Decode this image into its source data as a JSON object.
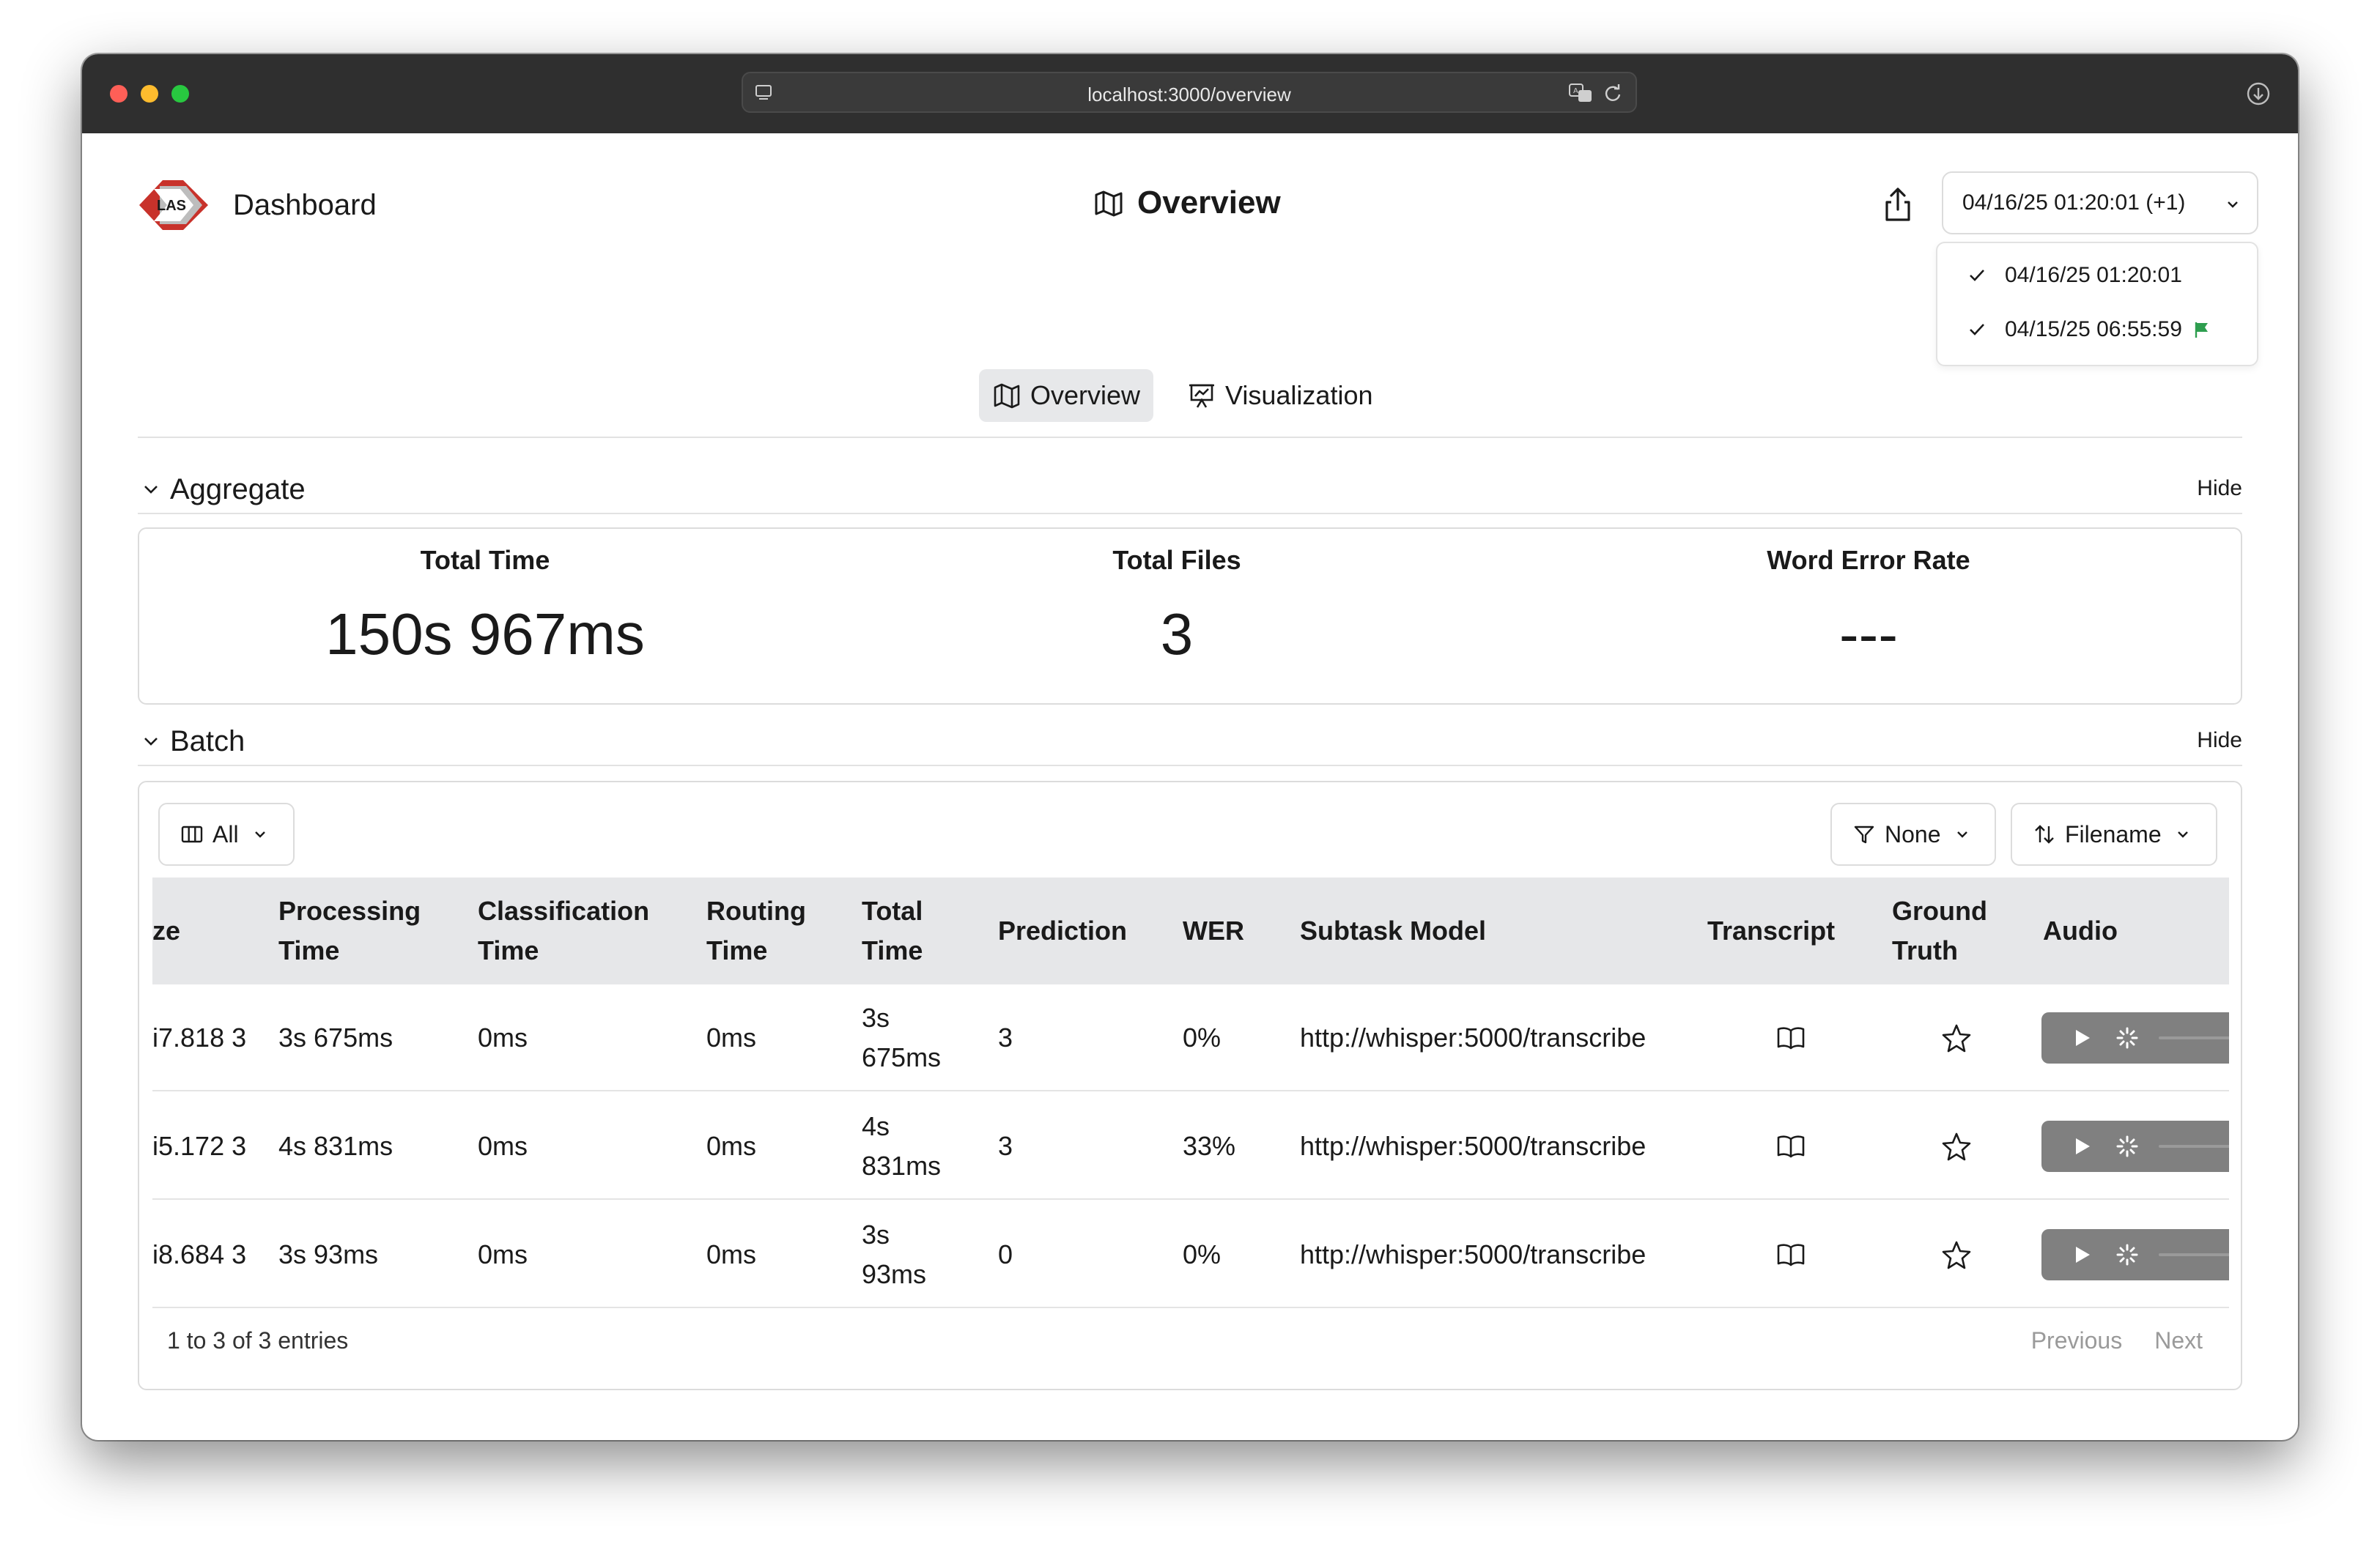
{
  "browser": {
    "url": "localhost:3000/overview"
  },
  "header": {
    "brand": "Dashboard",
    "logo_text": "LAS",
    "page_title": "Overview",
    "date_select": "04/16/25 01:20:01 (+1)",
    "date_options": [
      {
        "label": "04/16/25 01:20:01",
        "checked": true,
        "flag": false
      },
      {
        "label": "04/15/25 06:55:59",
        "checked": true,
        "flag": true
      }
    ]
  },
  "tabs": [
    {
      "label": "Overview",
      "active": true
    },
    {
      "label": "Visualization",
      "active": false
    }
  ],
  "aggregate": {
    "title": "Aggregate",
    "hide_label": "Hide",
    "metrics": [
      {
        "label": "Total Time",
        "value": "150s 967ms"
      },
      {
        "label": "Total Files",
        "value": "3"
      },
      {
        "label": "Word Error Rate",
        "value": "---"
      }
    ]
  },
  "batch": {
    "title": "Batch",
    "hide_label": "Hide",
    "columns_button": "All",
    "filter_button": "None",
    "sort_button": "Filename",
    "columns": [
      "ze",
      "Processing Time",
      "Classification Time",
      "Routing Time",
      "Total Time",
      "Prediction",
      "WER",
      "Subtask Model",
      "Transcript",
      "Ground Truth",
      "Audio"
    ],
    "rows": [
      {
        "size": "i7.818 3",
        "processing": "3s 675ms",
        "classification": "0ms",
        "routing": "0ms",
        "total": "3s 675ms",
        "prediction": "3",
        "wer": "0%",
        "model": "http://whisper:5000/transcribe"
      },
      {
        "size": "i5.172 3",
        "processing": "4s 831ms",
        "classification": "0ms",
        "routing": "0ms",
        "total": "4s 831ms",
        "prediction": "3",
        "wer": "33%",
        "model": "http://whisper:5000/transcribe"
      },
      {
        "size": "i8.684 3",
        "processing": "3s 93ms",
        "classification": "0ms",
        "routing": "0ms",
        "total": "3s 93ms",
        "prediction": "0",
        "wer": "0%",
        "model": "http://whisper:5000/transcribe"
      }
    ],
    "entries_info": "1 to 3 of 3 entries",
    "prev_label": "Previous",
    "next_label": "Next"
  },
  "colors": {
    "titlebar": "#2f2f2f",
    "logo_red": "#c8322b",
    "flag_green": "#2e9e4f",
    "header_row": "#e6e7e9"
  }
}
